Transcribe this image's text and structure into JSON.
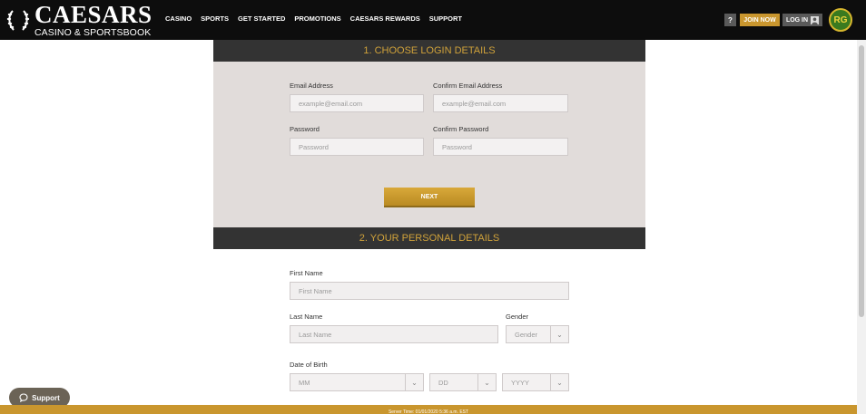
{
  "header": {
    "logo_name": "CAESARS",
    "logo_sub": "CASINO & SPORTSBOOK",
    "nav": [
      "CASINO",
      "SPORTS",
      "GET STARTED",
      "PROMOTIONS",
      "CAESARS REWARDS",
      "SUPPORT"
    ],
    "help_label": "?",
    "join_label": "JOIN NOW",
    "login_label": "LOG IN",
    "rg_label": "RG"
  },
  "login_section": {
    "title": "1. CHOOSE LOGIN DETAILS",
    "email_label": "Email Address",
    "email_placeholder": "example@email.com",
    "confirm_email_label": "Confirm Email Address",
    "confirm_email_placeholder": "example@email.com",
    "password_label": "Password",
    "password_placeholder": "Password",
    "confirm_password_label": "Confirm Password",
    "confirm_password_placeholder": "Password",
    "next_label": "NEXT"
  },
  "personal_section": {
    "title": "2. YOUR PERSONAL DETAILS",
    "first_name_label": "First Name",
    "first_name_placeholder": "First Name",
    "last_name_label": "Last Name",
    "last_name_placeholder": "Last Name",
    "gender_label": "Gender",
    "gender_value": "Gender",
    "dob_label": "Date of Birth",
    "dob_month": "MM",
    "dob_day": "DD",
    "dob_year": "YYYY"
  },
  "support_label": "Support",
  "footer_text": "Server Time: 01/01/2020 5:36 a.m. EST",
  "colors": {
    "accent": "#c9962e",
    "header_bg": "#0d0d0d",
    "section_bg": "#333333",
    "panel_bg": "#e1dcda"
  }
}
